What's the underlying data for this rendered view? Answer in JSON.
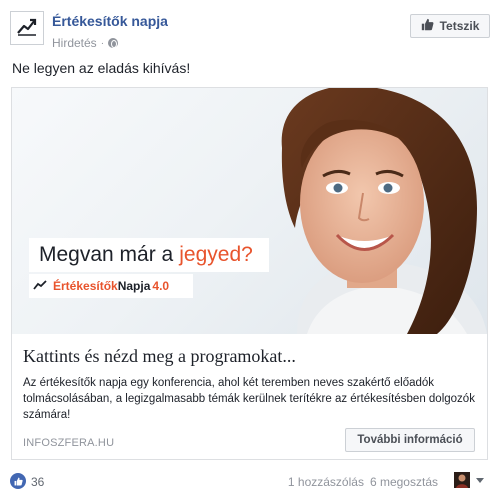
{
  "header": {
    "page_name": "Értékesítők napja",
    "sponsored_label": "Hirdetés",
    "separator": "·",
    "like_page_label": "Tetszik",
    "logo_icon": "trending-up-chart-icon",
    "audience_icon": "globe-icon"
  },
  "post": {
    "text": "Ne legyen az eladás kihívás!"
  },
  "ad": {
    "headline_main": "Megvan már a",
    "headline_accent": "jegyed?",
    "brand_part1": "Értékesítők",
    "brand_part2": "Napja",
    "brand_part3": "4.0",
    "title": "Kattints és nézd meg a programokat...",
    "description": "Az értékesítők napja egy konferencia, ahol két teremben neves szakértő előadók tolmácsolásában, a legizgalmasabb témák kerülnek terítékre az értékesítésben dolgozók számára!",
    "domain": "INFOSZFERA.HU",
    "cta_label": "További információ",
    "accent_color": "#e8542d"
  },
  "footer": {
    "like_count": "36",
    "comments": "1 hozzászólás",
    "shares": "6 megosztás",
    "like_icon": "thumbs-up-icon"
  },
  "colors": {
    "link_blue": "#365899",
    "facebook_blue": "#4267b2",
    "meta_gray": "#90949c"
  }
}
